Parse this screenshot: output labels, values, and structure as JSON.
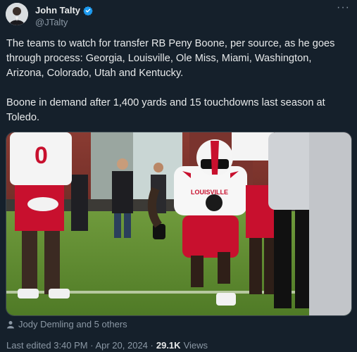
{
  "author": {
    "name": "John Talty",
    "handle": "@JTalty",
    "verified": true,
    "badge_color": "#1d9bf0"
  },
  "menu": {
    "more_label": "···"
  },
  "tweet": {
    "paragraphs": [
      "The teams to watch for transfer RB Peny Boone, per source, as he goes through process: Georgia, Louisville, Ole Miss, Miami, Washington, Arizona, Colorado, Utah and Kentucky.",
      "Boone in demand after 1,400 yards and 15 touchdowns last season at Toledo."
    ]
  },
  "media": {
    "type": "photo",
    "jersey_left_number": "0",
    "jersey_center_text": "LOUISVILLE"
  },
  "likers": {
    "icon": "person-icon",
    "text": "Jody Demling and 5 others"
  },
  "footer": {
    "edited": "Last edited 3:40 PM · Apr 20, 2024 ·",
    "views_count": "29.1K",
    "views_label": "Views"
  },
  "colors": {
    "background": "#15202b",
    "text": "#e7e9ea",
    "muted": "#8b98a5",
    "jersey_red": "#c8102e"
  }
}
